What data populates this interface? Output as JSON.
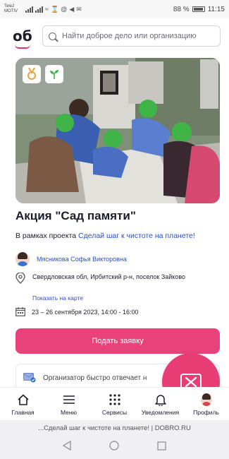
{
  "status_bar": {
    "carrier_line1": "Tele2",
    "carrier_line2": "MOTIV",
    "battery_percent": "88 %",
    "time": "11:15"
  },
  "header": {
    "logo_text": "об",
    "search_placeholder": "Найти доброе дело или организацию"
  },
  "event": {
    "title": "Акция \"Сад памяти\"",
    "project_prefix": "В рамках проекта ",
    "project_link": "Сделай шаг к чистоте на планете!",
    "organizer": "Мясникова Софья Викторовна",
    "address": "Свердловская обл, Ирбитский р-н, поселок Зайково",
    "map_link": "Показать на карте",
    "dates": "23 – 26 сентября 2023, 14:00 - 16:00",
    "apply_label": "Подать заявку",
    "notice_text": "Организатор быстро отвечает н"
  },
  "bottom_nav": [
    {
      "label": "Главная",
      "icon": "home-icon"
    },
    {
      "label": "Меню",
      "icon": "menu-icon"
    },
    {
      "label": "Сервисы",
      "icon": "grid-icon"
    },
    {
      "label": "Уведомления",
      "icon": "bell-icon"
    },
    {
      "label": "Профиль",
      "icon": "avatar"
    }
  ],
  "browser": {
    "url_text": "...Сделай шаг к чистоте на планете! | DOBRO.RU"
  },
  "colors": {
    "accent": "#e8427a",
    "link": "#2d4ec8",
    "text": "#1c1c2b"
  }
}
